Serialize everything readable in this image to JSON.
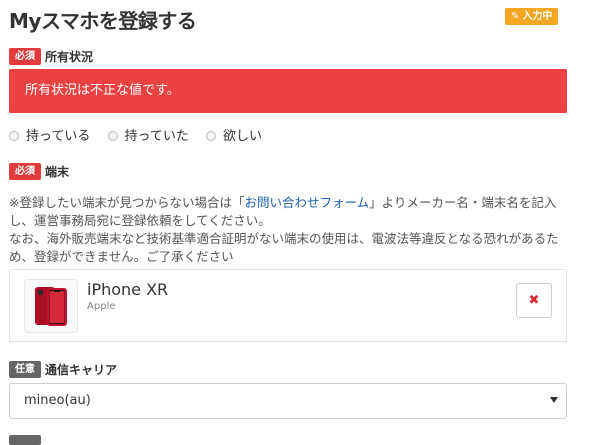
{
  "header": {
    "title": "Myスマホを登録する",
    "status_badge": "入力中"
  },
  "badges": {
    "required": "必須",
    "optional": "任意"
  },
  "ownership": {
    "label": "所有状況",
    "error": "所有状況は不正な値です。",
    "options": [
      "持っている",
      "持っていた",
      "欲しい"
    ]
  },
  "device": {
    "label": "端末",
    "notice_line1_pre": "※登録したい端末が見つからない場合は「",
    "notice_link": "お問い合わせフォーム",
    "notice_line1_post": "」よりメーカー名・端末名を記入し、運営事務局宛に登録依頼をしてください。",
    "notice_line2": "なお、海外販売端末など技術基準適合証明がない端末の使用は、電波法等違反となる恐れがあるため、登録ができません。ご了承ください",
    "name": "iPhone XR",
    "maker": "Apple",
    "remove_symbol": "✖"
  },
  "carrier": {
    "label": "通信キャリア",
    "selected": "mineo(au)"
  },
  "colors": {
    "required_badge": "#e33b3b",
    "optional_badge": "#666666",
    "error_background": "#ec4141",
    "status_badge": "#f5a623",
    "link": "#1a5fb4",
    "phone_red": "#c8102e"
  },
  "icons": {
    "status": "pencil-square-icon",
    "remove": "times-icon",
    "select": "caret-down-icon"
  }
}
